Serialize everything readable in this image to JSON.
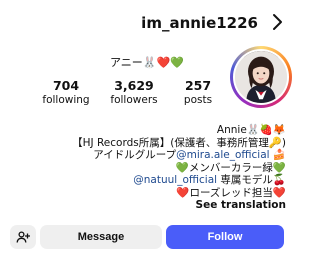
{
  "header": {
    "username": "im_annie1226"
  },
  "profile": {
    "display_name": "アニー🐰❤️💚"
  },
  "stats": {
    "posts": {
      "value": "257",
      "label": "posts"
    },
    "followers": {
      "value": "3,629",
      "label": "followers"
    },
    "following": {
      "value": "704",
      "label": "following"
    }
  },
  "bio": {
    "lines": [
      "Annie🐰🍓🦊",
      "【HJ Records所属】(保護者、事務所管理🔑)",
      "アイドルグループ@mira.ale_official 🍰",
      "💚メンバーカラー緑💚",
      "@natuul_official 専属モデル🍒",
      "❤️ローズレッド担当❤️",
      "See translation"
    ],
    "mention_1": "@mira.ale_official",
    "mention_2": "@natuul_official"
  },
  "actions": {
    "follow_label": "Follow",
    "message_label": "Message"
  },
  "colors": {
    "follow_button": "#4a5df9",
    "secondary_button": "#efefef",
    "mention": "#1f4a8f"
  },
  "icons": [
    "back-arrow-icon",
    "add-user-icon"
  ]
}
